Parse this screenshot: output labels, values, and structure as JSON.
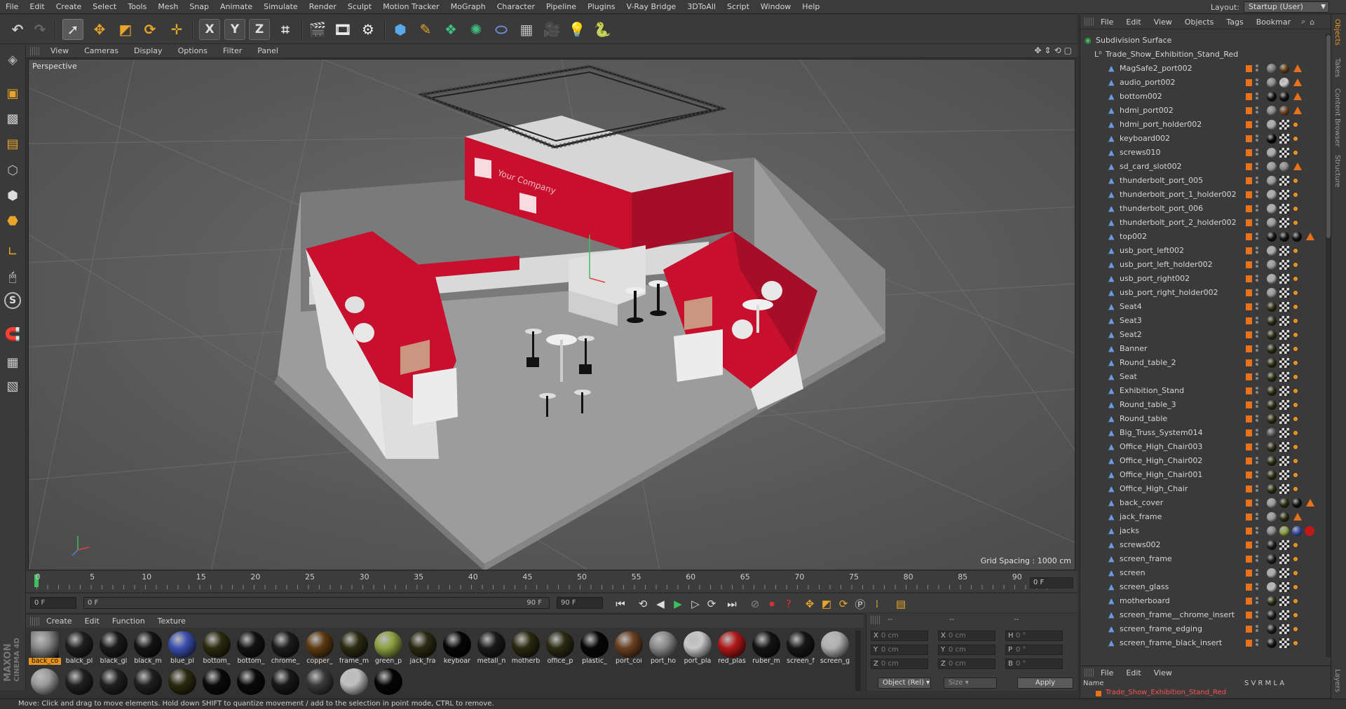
{
  "menubar": {
    "items": [
      "File",
      "Edit",
      "Create",
      "Select",
      "Tools",
      "Mesh",
      "Snap",
      "Animate",
      "Simulate",
      "Render",
      "Sculpt",
      "Motion Tracker",
      "MoGraph",
      "Character",
      "Pipeline",
      "Plugins",
      "V-Ray Bridge",
      "3DToAll",
      "Script",
      "Window",
      "Help"
    ],
    "layout_label": "Layout:",
    "layout_value": "Startup (User)"
  },
  "toolbar": {
    "axis_x": "X",
    "axis_y": "Y",
    "axis_z": "Z"
  },
  "left_tools": {
    "s_label": "S"
  },
  "viewport": {
    "menu": [
      "View",
      "Cameras",
      "Display",
      "Options",
      "Filter",
      "Panel"
    ],
    "camera_label": "Perspective",
    "grid_spacing": "Grid Spacing : 1000 cm",
    "banner_text": "Your Company"
  },
  "timeline": {
    "ticks": [
      "0",
      "5",
      "10",
      "15",
      "20",
      "25",
      "30",
      "35",
      "40",
      "45",
      "50",
      "55",
      "60",
      "65",
      "70",
      "75",
      "80",
      "85",
      "90"
    ],
    "current_frame_right": "0 F"
  },
  "transport": {
    "start_field": "0 F",
    "slider_left": "0 F",
    "slider_right": "90 F",
    "end_field": "90 F"
  },
  "material_manager": {
    "menu": [
      "Create",
      "Edit",
      "Function",
      "Texture"
    ],
    "materials": [
      {
        "name": "back_co",
        "color": "#8a8a8a",
        "selected": true
      },
      {
        "name": "balck_pl",
        "color": "#1f1f1f"
      },
      {
        "name": "black_gl",
        "color": "#1a1a1a"
      },
      {
        "name": "black_m",
        "color": "#141414"
      },
      {
        "name": "blue_pl",
        "color": "#3a4fb0"
      },
      {
        "name": "bottom_",
        "color": "#2b2b10"
      },
      {
        "name": "bottom_",
        "color": "#121212"
      },
      {
        "name": "chrome_",
        "color": "#1c1c1c"
      },
      {
        "name": "copper_",
        "color": "#5c3a12"
      },
      {
        "name": "frame_m",
        "color": "#2b2b12"
      },
      {
        "name": "green_p",
        "color": "#8da040"
      },
      {
        "name": "jack_fra",
        "color": "#2a2a12"
      },
      {
        "name": "keyboar",
        "color": "#050505"
      },
      {
        "name": "metall_n",
        "color": "#1a1a1a"
      },
      {
        "name": "motherb",
        "color": "#2a2a10"
      },
      {
        "name": "office_p",
        "color": "#2a2a12"
      },
      {
        "name": "plastic_",
        "color": "#060606"
      },
      {
        "name": "port_coi",
        "color": "#6a4020"
      },
      {
        "name": "port_ho",
        "color": "#8a8a8a"
      },
      {
        "name": "port_pla",
        "color": "#c8c8c8"
      },
      {
        "name": "red_plas",
        "color": "#b01818"
      },
      {
        "name": "ruber_m",
        "color": "#141414"
      },
      {
        "name": "screen_f",
        "color": "#161616"
      },
      {
        "name": "screen_g",
        "color": "#b0b0b0"
      }
    ],
    "row2_colors": [
      "#9a9a9a",
      "#202020",
      "#202020",
      "#202020",
      "#2a2a10",
      "#0a0a0a",
      "#0a0a0a",
      "#181818",
      "#3a3a3a",
      "#c0c0c0",
      "#050505"
    ]
  },
  "coordinates": {
    "rows": [
      {
        "a": "X",
        "av": "0 cm",
        "b": "X",
        "bv": "0 cm",
        "c": "H",
        "cv": "0 °"
      },
      {
        "a": "Y",
        "av": "0 cm",
        "b": "Y",
        "bv": "0 cm",
        "c": "P",
        "cv": "0 °"
      },
      {
        "a": "Z",
        "av": "0 cm",
        "b": "Z",
        "bv": "0 cm",
        "c": "B",
        "cv": "0 °"
      }
    ],
    "col_heads": [
      "--",
      "--",
      "--"
    ],
    "mode": "Object (Rel)",
    "size_mode": "Size",
    "apply": "Apply"
  },
  "object_manager": {
    "menu": [
      "File",
      "Edit",
      "View",
      "Objects",
      "Tags",
      "Bookmar"
    ],
    "root": "Subdivision Surface",
    "group": "Trade_Show_Exhibition_Stand_Red",
    "objects": [
      {
        "name": "MagSafe2_port002",
        "m1": "#777",
        "m2": "#5c3a12",
        "tri": true
      },
      {
        "name": "audio_port002",
        "m1": "#888",
        "m2": "#ccc",
        "tri": true
      },
      {
        "name": "bottom002",
        "m1": "#111",
        "m2": "#111",
        "tri": true
      },
      {
        "name": "hdmi_port002",
        "m1": "#888",
        "m2": "#6a4020",
        "tri": true
      },
      {
        "name": "hdmi_port_holder002",
        "m1": "#aaa",
        "chk": true
      },
      {
        "name": "keyboard002",
        "m1": "#050505",
        "chk": true
      },
      {
        "name": "screws010",
        "m1": "#aaa",
        "chk": true
      },
      {
        "name": "sd_card_slot002",
        "m1": "#999",
        "m2": "#888",
        "tri": true
      },
      {
        "name": "thunderbolt_port_005",
        "m1": "#999",
        "chk": true
      },
      {
        "name": "thunderbolt_port_1_holder002",
        "m1": "#aaa",
        "chk": true
      },
      {
        "name": "thunderbolt_port_006",
        "m1": "#aaa",
        "chk": true
      },
      {
        "name": "thunderbolt_port_2_holder002",
        "m1": "#999",
        "chk": true
      },
      {
        "name": "top002",
        "m1": "#111",
        "m2": "#111",
        "m3": "#111",
        "tri": true
      },
      {
        "name": "usb_port_left002",
        "m1": "#aaa",
        "chk": true
      },
      {
        "name": "usb_port_left_holder002",
        "m1": "#999",
        "chk": true
      },
      {
        "name": "usb_port_right002",
        "m1": "#aaa",
        "chk": true
      },
      {
        "name": "usb_port_right_holder002",
        "m1": "#999",
        "chk": true
      },
      {
        "name": "Seat4",
        "m1": "#2a2a12",
        "chk": true
      },
      {
        "name": "Seat3",
        "m1": "#2a2a12",
        "chk": true
      },
      {
        "name": "Seat2",
        "m1": "#2a2a12",
        "chk": true
      },
      {
        "name": "Banner",
        "m1": "#2a2a12",
        "chk": true
      },
      {
        "name": "Round_table_2",
        "m1": "#2a2a12",
        "chk": true
      },
      {
        "name": "Seat",
        "m1": "#2a2a12",
        "chk": true
      },
      {
        "name": "Exhibition_Stand",
        "m1": "#2a2a12",
        "chk": true
      },
      {
        "name": "Round_table_3",
        "m1": "#2a2a12",
        "chk": true
      },
      {
        "name": "Round_table",
        "m1": "#2a2a12",
        "chk": true
      },
      {
        "name": "Big_Truss_System014",
        "m1": "#555",
        "chk": true
      },
      {
        "name": "Office_High_Chair003",
        "m1": "#2a2a12",
        "chk": true
      },
      {
        "name": "Office_High_Chair002",
        "m1": "#2a2a12",
        "chk": true
      },
      {
        "name": "Office_High_Chair001",
        "m1": "#2a2a12",
        "chk": true
      },
      {
        "name": "Office_High_Chair",
        "m1": "#2a2a12",
        "chk": true
      },
      {
        "name": "back_cover",
        "m1": "#999",
        "m2": "#2a2a10",
        "m3": "#111",
        "tri": true
      },
      {
        "name": "jack_frame",
        "m1": "#999",
        "m2": "#2a2a10",
        "tri": true
      },
      {
        "name": "jacks",
        "m1": "#888",
        "m2": "#8da040",
        "m3": "#3a4fb0",
        "red": true
      },
      {
        "name": "screws002",
        "m1": "#1a1a1a",
        "chk": true
      },
      {
        "name": "screen_frame",
        "m1": "#1a1a1a",
        "chk": true
      },
      {
        "name": "screen",
        "m1": "#aaa",
        "chk": true
      },
      {
        "name": "screen_glass",
        "m1": "#bbb",
        "chk": true
      },
      {
        "name": "motherboard",
        "m1": "#2a2a10",
        "chk": true
      },
      {
        "name": "screen_frame__chrome_insert",
        "m1": "#1c1c1c",
        "chk": true
      },
      {
        "name": "screen_frame_edging",
        "m1": "#1c1c1c",
        "chk": true
      },
      {
        "name": "screen_frame_black_insert",
        "m1": "#141414",
        "chk": true
      }
    ]
  },
  "layers_panel": {
    "menu": [
      "File",
      "Edit",
      "View"
    ],
    "name_header": "Name",
    "cols": "S V R M L A",
    "row": "Trade_Show_Exhibition_Stand_Red"
  },
  "side_tabs": [
    "Objects",
    "Takes",
    "Content Browser",
    "Structure",
    "Layers"
  ],
  "status": "Move: Click and drag to move elements. Hold down SHIFT to quantize movement / add to the selection in point mode, CTRL to remove.",
  "colors": {
    "accent": "#e8951f",
    "stand_red": "#c8102e",
    "tag_orange": "#e8721c"
  }
}
